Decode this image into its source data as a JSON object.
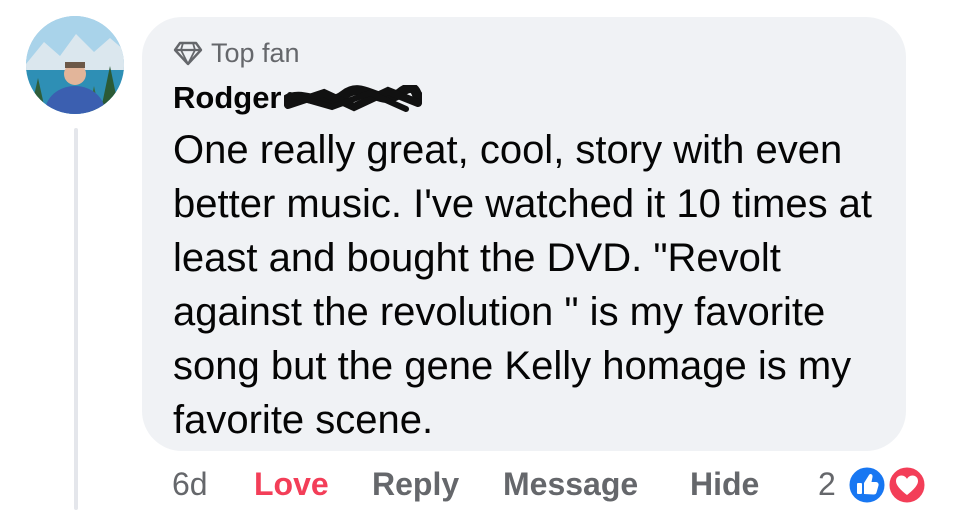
{
  "comment": {
    "badge": {
      "icon": "diamond-icon",
      "label": "Top fan"
    },
    "author": "Rodger",
    "text": "One really great, cool, story with even better music. I've watched it 10 times at least and bought the DVD.  \"Revolt against the revolution \" is my favorite song but the gene Kelly homage is my favorite scene."
  },
  "actions": {
    "time": "6d",
    "love": "Love",
    "reply": "Reply",
    "message": "Message",
    "hide": "Hide",
    "reaction_count": "2",
    "reactions": [
      "like-icon",
      "love-icon"
    ]
  },
  "colors": {
    "bubble_bg": "#f0f2f5",
    "secondary_text": "#65676b",
    "love_red": "#f33e58",
    "like_blue": "#1877f2"
  }
}
